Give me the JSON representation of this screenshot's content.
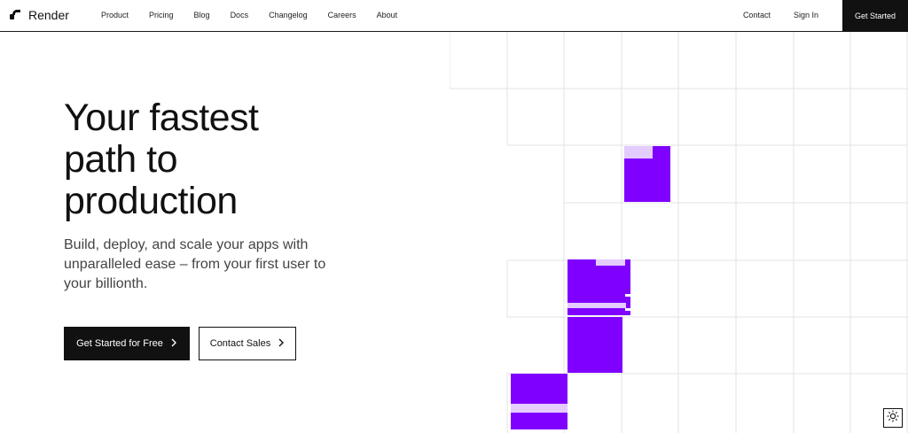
{
  "header": {
    "brand": "Render",
    "nav": [
      "Product",
      "Pricing",
      "Blog",
      "Docs",
      "Changelog",
      "Careers",
      "About"
    ],
    "contact": "Contact",
    "sign_in": "Sign In",
    "get_started": "Get Started"
  },
  "hero": {
    "title_line1": "Your fastest",
    "title_line2": "path to",
    "title_line3": "production",
    "subtitle": "Build, deploy, and scale your apps with unparalleled ease – from your first user to your billionth.",
    "primary_cta": "Get Started for Free",
    "secondary_cta": "Contact Sales"
  },
  "colors": {
    "accent": "#8000ff",
    "accent_light": "#e4ccff",
    "grid_line": "#e5e5e5",
    "dark": "#111111"
  },
  "icons": {
    "logo": "render-logo-icon",
    "chevron": "chevron-right-icon",
    "theme": "sun-icon"
  }
}
